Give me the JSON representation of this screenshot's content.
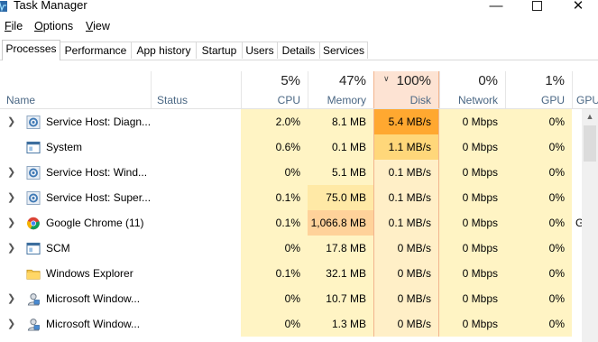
{
  "window": {
    "title": "Task Manager"
  },
  "menu": {
    "file": "File",
    "options": "Options",
    "view": "View"
  },
  "tabs": [
    "Processes",
    "Performance",
    "App history",
    "Startup",
    "Users",
    "Details",
    "Services"
  ],
  "columns": {
    "name": "Name",
    "status": "Status",
    "cpu": {
      "pct": "5%",
      "label": "CPU"
    },
    "memory": {
      "pct": "47%",
      "label": "Memory"
    },
    "disk": {
      "pct": "100%",
      "label": "Disk"
    },
    "network": {
      "pct": "0%",
      "label": "Network"
    },
    "gpu": {
      "pct": "1%",
      "label": "GPU"
    },
    "gpu_engine_label": "GPU"
  },
  "colors": {
    "cell_light": "#fff4c4",
    "cell_mid": "#ffe9a6",
    "disk_col": "#ffefc7",
    "disk_high": "#ffa830",
    "disk_mid": "#ffd77a",
    "memory_high": "#ffd29a",
    "disk_header": "#fde3d3",
    "accent_border": "#f2b48e"
  },
  "processes": [
    {
      "name": "Service Host: Diagn...",
      "expandable": true,
      "icon": "gear-icon",
      "cpu": "2.0%",
      "memory": "8.1 MB",
      "disk": "5.4 MB/s",
      "network": "0 Mbps",
      "gpu": "0%",
      "gpu_engine": ""
    },
    {
      "name": "System",
      "expandable": false,
      "icon": "window-icon",
      "cpu": "0.6%",
      "memory": "0.1 MB",
      "disk": "1.1 MB/s",
      "network": "0 Mbps",
      "gpu": "0%",
      "gpu_engine": ""
    },
    {
      "name": "Service Host: Wind...",
      "expandable": true,
      "icon": "gear-icon",
      "cpu": "0%",
      "memory": "5.1 MB",
      "disk": "0.1 MB/s",
      "network": "0 Mbps",
      "gpu": "0%",
      "gpu_engine": ""
    },
    {
      "name": "Service Host: Super...",
      "expandable": true,
      "icon": "gear-icon",
      "cpu": "0.1%",
      "memory": "75.0 MB",
      "disk": "0.1 MB/s",
      "network": "0 Mbps",
      "gpu": "0%",
      "gpu_engine": ""
    },
    {
      "name": "Google Chrome (11)",
      "expandable": true,
      "icon": "chrome-icon",
      "cpu": "0.1%",
      "memory": "1,066.8 MB",
      "disk": "0.1 MB/s",
      "network": "0 Mbps",
      "gpu": "0%",
      "gpu_engine": "G"
    },
    {
      "name": "SCM",
      "expandable": true,
      "icon": "window-icon",
      "cpu": "0%",
      "memory": "17.8 MB",
      "disk": "0 MB/s",
      "network": "0 Mbps",
      "gpu": "0%",
      "gpu_engine": ""
    },
    {
      "name": "Windows Explorer",
      "expandable": false,
      "icon": "folder-icon",
      "cpu": "0.1%",
      "memory": "32.1 MB",
      "disk": "0 MB/s",
      "network": "0 Mbps",
      "gpu": "0%",
      "gpu_engine": ""
    },
    {
      "name": "Microsoft Window...",
      "expandable": true,
      "icon": "user-icon",
      "cpu": "0%",
      "memory": "10.7 MB",
      "disk": "0 MB/s",
      "network": "0 Mbps",
      "gpu": "0%",
      "gpu_engine": ""
    },
    {
      "name": "Microsoft Window...",
      "expandable": true,
      "icon": "user-icon",
      "cpu": "0%",
      "memory": "1.3 MB",
      "disk": "0 MB/s",
      "network": "0 Mbps",
      "gpu": "0%",
      "gpu_engine": ""
    }
  ]
}
